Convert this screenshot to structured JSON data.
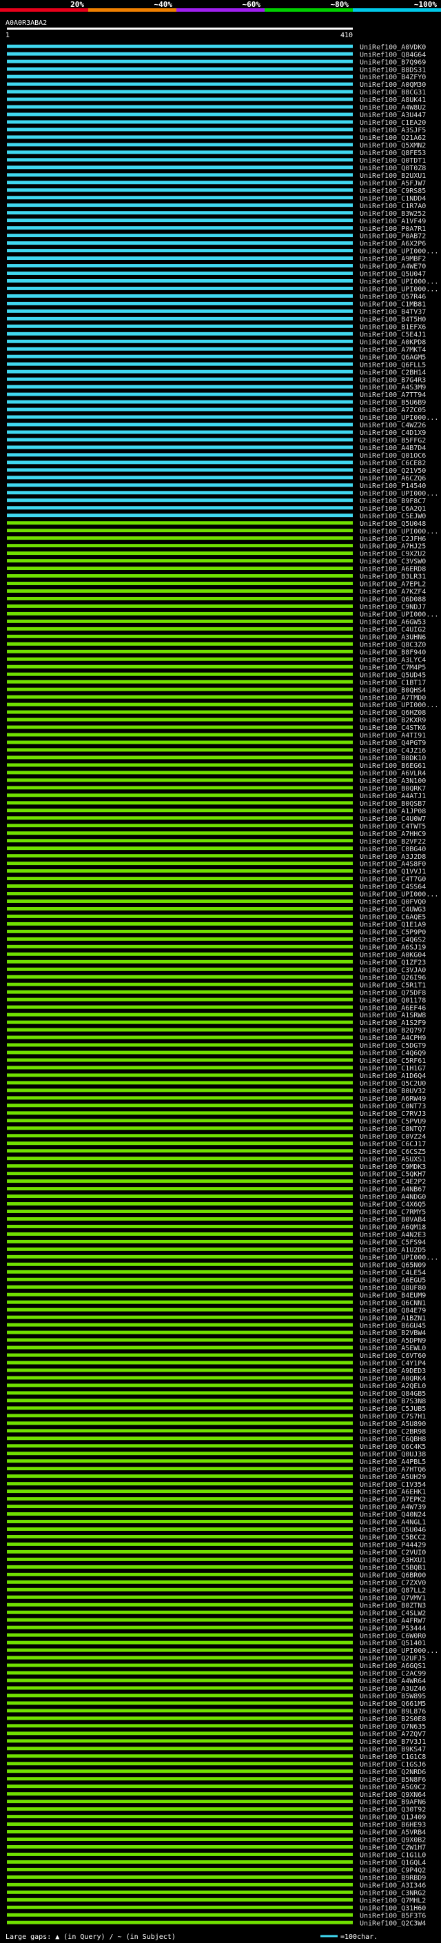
{
  "page": {
    "query_id": "A0A0R3ABA2",
    "query_start_label": "1",
    "query_end_label": "410",
    "footer_text": "Large gaps: ▲ (in Query) / ~ (in Subject)",
    "scale_text": "=100char."
  },
  "colors": {
    "background": "#000000",
    "band_0_20": "#e8001a",
    "band_20_40": "#f08000",
    "band_40_60": "#a020f0",
    "band_60_80": "#00d000",
    "band_80_100": "#00c8e8",
    "bar_high": "#40d8f0",
    "bar_mid": "#70e000",
    "text": "#ffffff",
    "label": "#dddddd",
    "gap": "#808080"
  },
  "legend": {
    "labels": [
      "20%",
      "~40%",
      "~60%",
      "~80%",
      "~100%"
    ]
  },
  "chart_data": {
    "type": "bar",
    "xlabel": "",
    "ylabel": "",
    "x_range": [
      1,
      410
    ],
    "hits": [
      {
        "name": "UniRef100_A0VDK0",
        "identity": 100
      },
      {
        "name": "UniRef100_Q84G64",
        "identity": 98
      },
      {
        "name": "UniRef100_B7Q969",
        "identity": 97
      },
      {
        "name": "UniRef100_B8DS31",
        "identity": 96
      },
      {
        "name": "UniRef100_B4ZFY0",
        "identity": 96
      },
      {
        "name": "UniRef100_A0QM30",
        "identity": 95
      },
      {
        "name": "UniRef100_B8CG31",
        "identity": 95
      },
      {
        "name": "UniRef100_A8UK41",
        "identity": 95
      },
      {
        "name": "UniRef100_A4W8U2",
        "identity": 94
      },
      {
        "name": "UniRef100_A3U447",
        "identity": 94
      },
      {
        "name": "UniRef100_C1EA20",
        "identity": 94
      },
      {
        "name": "UniRef100_A3SJF5",
        "identity": 94
      },
      {
        "name": "UniRef100_Q21A62",
        "identity": 93
      },
      {
        "name": "UniRef100_Q5XMN2",
        "identity": 93
      },
      {
        "name": "UniRef100_Q8FE53",
        "identity": 93
      },
      {
        "name": "UniRef100_Q0TDT1",
        "identity": 93
      },
      {
        "name": "UniRef100_Q0T0Z8",
        "identity": 93
      },
      {
        "name": "UniRef100_B2UXU1",
        "identity": 92
      },
      {
        "name": "UniRef100_A5FJW7",
        "identity": 92
      },
      {
        "name": "UniRef100_C9RS85",
        "identity": 92
      },
      {
        "name": "UniRef100_C1NDD4",
        "identity": 92
      },
      {
        "name": "UniRef100_C1R7A0",
        "identity": 92
      },
      {
        "name": "UniRef100_B3W252",
        "identity": 92
      },
      {
        "name": "UniRef100_A1VF49",
        "identity": 91
      },
      {
        "name": "UniRef100_P0A7R1",
        "identity": 91
      },
      {
        "name": "UniRef100_P0AB72",
        "identity": 91
      },
      {
        "name": "UniRef100_A6X2P6",
        "identity": 91
      },
      {
        "name": "UniRef100_UPI000...",
        "identity": 91
      },
      {
        "name": "UniRef100_A9MBF2",
        "identity": 91
      },
      {
        "name": "UniRef100_A4WE70",
        "identity": 90
      },
      {
        "name": "UniRef100_Q5U047",
        "identity": 90
      },
      {
        "name": "UniRef100_UPI000...",
        "identity": 90
      },
      {
        "name": "UniRef100_UPI000...",
        "identity": 90
      },
      {
        "name": "UniRef100_Q57R46",
        "identity": 90
      },
      {
        "name": "UniRef100_C1MB81",
        "identity": 90
      },
      {
        "name": "UniRef100_B4TV37",
        "identity": 89
      },
      {
        "name": "UniRef100_B4T5H0",
        "identity": 89
      },
      {
        "name": "UniRef100_B1EFX6",
        "identity": 89
      },
      {
        "name": "UniRef100_C5E4J1",
        "identity": 89
      },
      {
        "name": "UniRef100_A0KPD8",
        "identity": 89
      },
      {
        "name": "UniRef100_A7MKT4",
        "identity": 89
      },
      {
        "name": "UniRef100_Q6AGM5",
        "identity": 88
      },
      {
        "name": "UniRef100_Q6FLL5",
        "identity": 88
      },
      {
        "name": "UniRef100_C2BH14",
        "identity": 88
      },
      {
        "name": "UniRef100_B7G4R3",
        "identity": 88
      },
      {
        "name": "UniRef100_A4S3M9",
        "identity": 88
      },
      {
        "name": "UniRef100_A7TT94",
        "identity": 88
      },
      {
        "name": "UniRef100_B5U6B9",
        "identity": 87
      },
      {
        "name": "UniRef100_A7ZC05",
        "identity": 87
      },
      {
        "name": "UniRef100_UPI000...",
        "identity": 87
      },
      {
        "name": "UniRef100_C4WZ26",
        "identity": 87
      },
      {
        "name": "UniRef100_C4D1X9",
        "identity": 87
      },
      {
        "name": "UniRef100_B5FFG2",
        "identity": 87
      },
      {
        "name": "UniRef100_A4B7D4",
        "identity": 86
      },
      {
        "name": "UniRef100_Q01OC6",
        "identity": 86
      },
      {
        "name": "UniRef100_C6CE82",
        "identity": 86
      },
      {
        "name": "UniRef100_Q21V50",
        "identity": 86
      },
      {
        "name": "UniRef100_A6CZQ6",
        "identity": 86
      },
      {
        "name": "UniRef100_P14540",
        "identity": 85
      },
      {
        "name": "UniRef100_UPI000...",
        "identity": 85
      },
      {
        "name": "UniRef100_B9F8C7",
        "identity": 85
      },
      {
        "name": "UniRef100_C6A2Q1",
        "identity": 85
      },
      {
        "name": "UniRef100_C5EJW0",
        "identity": 85
      },
      {
        "name": "UniRef100_Q5U048",
        "identity": 84
      },
      {
        "name": "UniRef100_UPI000...",
        "identity": 84
      },
      {
        "name": "UniRef100_C2JFH6",
        "identity": 84
      },
      {
        "name": "UniRef100_A7HJ25",
        "identity": 84
      },
      {
        "name": "UniRef100_C9XZU2",
        "identity": 84
      },
      {
        "name": "UniRef100_C3VSW0",
        "identity": 84
      },
      {
        "name": "UniRef100_A6ERD8",
        "identity": 83
      },
      {
        "name": "UniRef100_B3LR31",
        "identity": 83
      },
      {
        "name": "UniRef100_A7EPL2",
        "identity": 83
      },
      {
        "name": "UniRef100_A7KZF4",
        "identity": 83
      },
      {
        "name": "UniRef100_Q6D088",
        "identity": 83
      },
      {
        "name": "UniRef100_C9NDJ7",
        "identity": 83
      },
      {
        "name": "UniRef100_UPI000...",
        "identity": 82
      },
      {
        "name": "UniRef100_A6GW53",
        "identity": 82
      },
      {
        "name": "UniRef100_C4UIG2",
        "identity": 82
      },
      {
        "name": "UniRef100_A3UHN6",
        "identity": 82
      },
      {
        "name": "UniRef100_Q8C3Z0",
        "identity": 82
      },
      {
        "name": "UniRef100_B8F940",
        "identity": 81
      },
      {
        "name": "UniRef100_A3LYC4",
        "identity": 81
      },
      {
        "name": "UniRef100_C7M4P5",
        "identity": 81
      },
      {
        "name": "UniRef100_Q5UD45",
        "identity": 81
      },
      {
        "name": "UniRef100_C1BT17",
        "identity": 81
      },
      {
        "name": "UniRef100_B0QHS4",
        "identity": 81
      },
      {
        "name": "UniRef100_A7TMD0",
        "identity": 80
      },
      {
        "name": "UniRef100_UPI000...",
        "identity": 80
      },
      {
        "name": "UniRef100_Q6HZ08",
        "identity": 80
      },
      {
        "name": "UniRef100_B2KXR9",
        "identity": 80
      },
      {
        "name": "UniRef100_C4STK6",
        "identity": 80
      },
      {
        "name": "UniRef100_A4TI91",
        "identity": 80
      },
      {
        "name": "UniRef100_Q4PGT9",
        "identity": 80
      },
      {
        "name": "UniRef100_C4JZ16",
        "identity": 80
      },
      {
        "name": "UniRef100_B0DK10",
        "identity": 80
      },
      {
        "name": "UniRef100_B6EG61",
        "identity": 80
      },
      {
        "name": "UniRef100_A6VLR4",
        "identity": 80
      },
      {
        "name": "UniRef100_A3N100",
        "identity": 80
      },
      {
        "name": "UniRef100_B0QRK7",
        "identity": 80
      },
      {
        "name": "UniRef100_A4ATJ1",
        "identity": 80
      },
      {
        "name": "UniRef100_B0QSB7",
        "identity": 80
      },
      {
        "name": "UniRef100_A1JP08",
        "identity": 80
      },
      {
        "name": "UniRef100_C4U0W7",
        "identity": 80
      },
      {
        "name": "UniRef100_C4TWT5",
        "identity": 80
      },
      {
        "name": "UniRef100_A7HHC9",
        "identity": 80
      },
      {
        "name": "UniRef100_B2VF22",
        "identity": 80
      },
      {
        "name": "UniRef100_C0BG40",
        "identity": 80
      },
      {
        "name": "UniRef100_A3J2D8",
        "identity": 80
      },
      {
        "name": "UniRef100_A4S8F0",
        "identity": 80
      },
      {
        "name": "UniRef100_Q1VVJ1",
        "identity": 80
      },
      {
        "name": "UniRef100_C4T7G0",
        "identity": 80
      },
      {
        "name": "UniRef100_C4SS64",
        "identity": 80
      },
      {
        "name": "UniRef100_UPI000...",
        "identity": 80
      },
      {
        "name": "UniRef100_Q0FVQ0",
        "identity": 80
      },
      {
        "name": "UniRef100_C4UWG3",
        "identity": 80
      },
      {
        "name": "UniRef100_C6AQE5",
        "identity": 80
      },
      {
        "name": "UniRef100_Q1E1A9",
        "identity": 80
      },
      {
        "name": "UniRef100_C5P9P0",
        "identity": 80
      },
      {
        "name": "UniRef100_C4Q6S2",
        "identity": 80
      },
      {
        "name": "UniRef100_A6SJ19",
        "identity": 80
      },
      {
        "name": "UniRef100_A0KG04",
        "identity": 80
      },
      {
        "name": "UniRef100_Q1ZF23",
        "identity": 80
      },
      {
        "name": "UniRef100_C3VJA0",
        "identity": 80
      },
      {
        "name": "UniRef100_Q26I96",
        "identity": 80
      },
      {
        "name": "UniRef100_C5R1T1",
        "identity": 80
      },
      {
        "name": "UniRef100_Q75DF8",
        "identity": 80
      },
      {
        "name": "UniRef100_Q01178",
        "identity": 80
      },
      {
        "name": "UniRef100_A6EF46",
        "identity": 80
      },
      {
        "name": "UniRef100_A1SRW8",
        "identity": 80
      },
      {
        "name": "UniRef100_A1S2F9",
        "identity": 80
      },
      {
        "name": "UniRef100_B2Q797",
        "identity": 80
      },
      {
        "name": "UniRef100_A4CPH9",
        "identity": 80
      },
      {
        "name": "UniRef100_C5DGT9",
        "identity": 80
      },
      {
        "name": "UniRef100_C4Q6Q9",
        "identity": 80
      },
      {
        "name": "UniRef100_C5RF61",
        "identity": 80
      },
      {
        "name": "UniRef100_C1H1G7",
        "identity": 80
      },
      {
        "name": "UniRef100_A1D6Q4",
        "identity": 80
      },
      {
        "name": "UniRef100_Q5C2U0",
        "identity": 80
      },
      {
        "name": "UniRef100_B0UV32",
        "identity": 80
      },
      {
        "name": "UniRef100_A6RW49",
        "identity": 80
      },
      {
        "name": "UniRef100_C0NT73",
        "identity": 80
      },
      {
        "name": "UniRef100_C7RVJ3",
        "identity": 80
      },
      {
        "name": "UniRef100_C5PVU9",
        "identity": 80
      },
      {
        "name": "UniRef100_C8NTQ7",
        "identity": 80
      },
      {
        "name": "UniRef100_C0VZ24",
        "identity": 80
      },
      {
        "name": "UniRef100_C6CJ17",
        "identity": 80
      },
      {
        "name": "UniRef100_C6CSZ5",
        "identity": 80
      },
      {
        "name": "UniRef100_A5UXS1",
        "identity": 80
      },
      {
        "name": "UniRef100_C9MDK3",
        "identity": 80
      },
      {
        "name": "UniRef100_C5QKH7",
        "identity": 80
      },
      {
        "name": "UniRef100_C4E2P2",
        "identity": 80
      },
      {
        "name": "UniRef100_A4NB67",
        "identity": 80
      },
      {
        "name": "UniRef100_A4NDG0",
        "identity": 80
      },
      {
        "name": "UniRef100_C4X6Q5",
        "identity": 80
      },
      {
        "name": "UniRef100_C7RMY5",
        "identity": 80
      },
      {
        "name": "UniRef100_B0VAB4",
        "identity": 80
      },
      {
        "name": "UniRef100_A6QM18",
        "identity": 80
      },
      {
        "name": "UniRef100_A4N2E3",
        "identity": 80
      },
      {
        "name": "UniRef100_C5FS94",
        "identity": 80
      },
      {
        "name": "UniRef100_A1U2D5",
        "identity": 80
      },
      {
        "name": "UniRef100_UPI000...",
        "identity": 80
      },
      {
        "name": "UniRef100_Q65N09",
        "identity": 80
      },
      {
        "name": "UniRef100_C4LE54",
        "identity": 80
      },
      {
        "name": "UniRef100_A6EGU5",
        "identity": 80
      },
      {
        "name": "UniRef100_Q8UF80",
        "identity": 80
      },
      {
        "name": "UniRef100_B4EUM9",
        "identity": 80
      },
      {
        "name": "UniRef100_Q6CNN1",
        "identity": 80
      },
      {
        "name": "UniRef100_Q84E79",
        "identity": 80
      },
      {
        "name": "UniRef100_A1BZN1",
        "identity": 80
      },
      {
        "name": "UniRef100_B6GU45",
        "identity": 80
      },
      {
        "name": "UniRef100_B2VBW4",
        "identity": 80
      },
      {
        "name": "UniRef100_A5DPN9",
        "identity": 80
      },
      {
        "name": "UniRef100_A5EWL0",
        "identity": 80
      },
      {
        "name": "UniRef100_C6VT60",
        "identity": 80
      },
      {
        "name": "UniRef100_C4Y1P4",
        "identity": 80
      },
      {
        "name": "UniRef100_A9DED3",
        "identity": 80
      },
      {
        "name": "UniRef100_A0QRK4",
        "identity": 80
      },
      {
        "name": "UniRef100_A2QEL0",
        "identity": 80
      },
      {
        "name": "UniRef100_Q84GB5",
        "identity": 80
      },
      {
        "name": "UniRef100_B7S3N8",
        "identity": 80
      },
      {
        "name": "UniRef100_C5JUB5",
        "identity": 80
      },
      {
        "name": "UniRef100_C7S7H1",
        "identity": 80
      },
      {
        "name": "UniRef100_A5U890",
        "identity": 80
      },
      {
        "name": "UniRef100_C2BR98",
        "identity": 80
      },
      {
        "name": "UniRef100_C6QBH8",
        "identity": 80
      },
      {
        "name": "UniRef100_Q6C4K5",
        "identity": 80
      },
      {
        "name": "UniRef100_Q0UJ38",
        "identity": 80
      },
      {
        "name": "UniRef100_A4PBL5",
        "identity": 80
      },
      {
        "name": "UniRef100_A7HTQ6",
        "identity": 80
      },
      {
        "name": "UniRef100_A5UH29",
        "identity": 80
      },
      {
        "name": "UniRef100_C1V354",
        "identity": 80
      },
      {
        "name": "UniRef100_A6EHK1",
        "identity": 80
      },
      {
        "name": "UniRef100_A7EPK2",
        "identity": 80
      },
      {
        "name": "UniRef100_A4W739",
        "identity": 80
      },
      {
        "name": "UniRef100_Q40N24",
        "identity": 80
      },
      {
        "name": "UniRef100_A4NGL1",
        "identity": 80
      },
      {
        "name": "UniRef100_Q5U046",
        "identity": 80
      },
      {
        "name": "UniRef100_C5BCC2",
        "identity": 80
      },
      {
        "name": "UniRef100_P44429",
        "identity": 80
      },
      {
        "name": "UniRef100_C2VUI0",
        "identity": 80
      },
      {
        "name": "UniRef100_A3HXU1",
        "identity": 80
      },
      {
        "name": "UniRef100_C5BQB1",
        "identity": 80
      },
      {
        "name": "UniRef100_Q6BR00",
        "identity": 80
      },
      {
        "name": "UniRef100_C7ZXV0",
        "identity": 80
      },
      {
        "name": "UniRef100_Q87LL2",
        "identity": 80
      },
      {
        "name": "UniRef100_Q7VMV1",
        "identity": 80
      },
      {
        "name": "UniRef100_B0ZTN3",
        "identity": 80
      },
      {
        "name": "UniRef100_C4SLW2",
        "identity": 80
      },
      {
        "name": "UniRef100_A4FRW7",
        "identity": 80
      },
      {
        "name": "UniRef100_P53444",
        "identity": 80
      },
      {
        "name": "UniRef100_C6W0R0",
        "identity": 80
      },
      {
        "name": "UniRef100_Q51401",
        "identity": 80
      },
      {
        "name": "UniRef100_UPI000...",
        "identity": 80
      },
      {
        "name": "UniRef100_Q2UFJ5",
        "identity": 80
      },
      {
        "name": "UniRef100_A6GQS1",
        "identity": 80
      },
      {
        "name": "UniRef100_C2AC99",
        "identity": 80
      },
      {
        "name": "UniRef100_A4WR64",
        "identity": 80
      },
      {
        "name": "UniRef100_A3UZ46",
        "identity": 80
      },
      {
        "name": "UniRef100_B5W895",
        "identity": 80
      },
      {
        "name": "UniRef100_Q661M5",
        "identity": 80
      },
      {
        "name": "UniRef100_B9L876",
        "identity": 80
      },
      {
        "name": "UniRef100_B2S0E8",
        "identity": 80
      },
      {
        "name": "UniRef100_Q7N635",
        "identity": 80
      },
      {
        "name": "UniRef100_A7ZQV7",
        "identity": 80
      },
      {
        "name": "UniRef100_B7V3J1",
        "identity": 80
      },
      {
        "name": "UniRef100_B9KS47",
        "identity": 80
      },
      {
        "name": "UniRef100_C1G1C8",
        "identity": 80
      },
      {
        "name": "UniRef100_C1GSJ6",
        "identity": 80
      },
      {
        "name": "UniRef100_Q2NRD6",
        "identity": 80
      },
      {
        "name": "UniRef100_B5N8F6",
        "identity": 80
      },
      {
        "name": "UniRef100_A5G9C2",
        "identity": 80
      },
      {
        "name": "UniRef100_Q9XN64",
        "identity": 80
      },
      {
        "name": "UniRef100_B9AFN6",
        "identity": 80
      },
      {
        "name": "UniRef100_Q30T92",
        "identity": 80
      },
      {
        "name": "UniRef100_Q1J409",
        "identity": 80
      },
      {
        "name": "UniRef100_B6HE93",
        "identity": 80
      },
      {
        "name": "UniRef100_A5VRB4",
        "identity": 80
      },
      {
        "name": "UniRef100_Q9X0B2",
        "identity": 80
      },
      {
        "name": "UniRef100_C2W1H7",
        "identity": 80
      },
      {
        "name": "UniRef100_C1G1L0",
        "identity": 80
      },
      {
        "name": "UniRef100_Q1GQL4",
        "identity": 80
      },
      {
        "name": "UniRef100_C9P4Q2",
        "identity": 80
      },
      {
        "name": "UniRef100_B9RBD9",
        "identity": 80
      },
      {
        "name": "UniRef100_A3I346",
        "identity": 80
      },
      {
        "name": "UniRef100_C3NRG2",
        "identity": 80
      },
      {
        "name": "UniRef100_Q7MHL2",
        "identity": 80
      },
      {
        "name": "UniRef100_Q31H60",
        "identity": 80
      },
      {
        "name": "UniRef100_B5F3T6",
        "identity": 80
      },
      {
        "name": "UniRef100_Q2C3W4",
        "identity": 80
      }
    ]
  }
}
